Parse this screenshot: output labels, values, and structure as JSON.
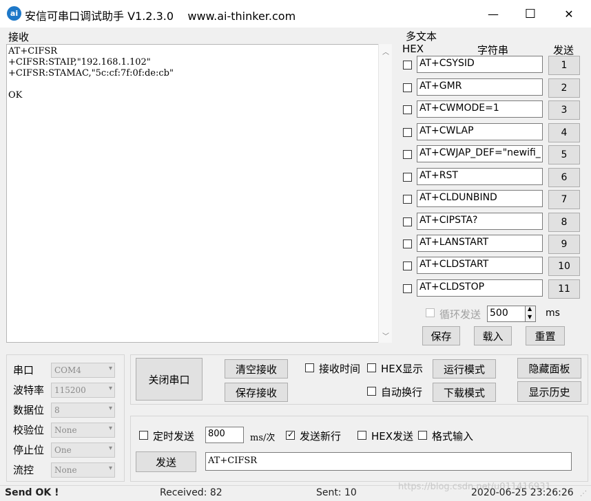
{
  "window": {
    "title": "安信可串口调试助手 V1.2.3.0    www.ai-thinker.com",
    "icon_text": "ai",
    "controls": {
      "minimize": "—",
      "maximize": "☐",
      "close": "✕"
    }
  },
  "receive": {
    "label": "接收",
    "lines": "AT+CIFSR\n+CIFSR:STAIP,\"192.168.1.102\"\n+CIFSR:STAMAC,\"5c:cf:7f:0f:de:cb\"\n\nOK"
  },
  "multi": {
    "label": "多文本",
    "hex_header": "HEX",
    "string_header": "字符串",
    "send_header": "发送",
    "rows": [
      {
        "text": "AT+CSYSID",
        "num": "1"
      },
      {
        "text": "AT+GMR",
        "num": "2"
      },
      {
        "text": "AT+CWMODE=1",
        "num": "3"
      },
      {
        "text": "AT+CWLAP",
        "num": "4"
      },
      {
        "text": "AT+CWJAP_DEF=\"newifi_",
        "num": "5"
      },
      {
        "text": "AT+RST",
        "num": "6"
      },
      {
        "text": "AT+CLDUNBIND",
        "num": "7"
      },
      {
        "text": "AT+CIPSTA?",
        "num": "8"
      },
      {
        "text": "AT+LANSTART",
        "num": "9"
      },
      {
        "text": "AT+CLDSTART",
        "num": "10"
      },
      {
        "text": "AT+CLDSTOP",
        "num": "11"
      }
    ],
    "loop_label": "循环发送",
    "loop_value": "500",
    "loop_unit": "ms",
    "save": "保存",
    "load": "载入",
    "reset": "重置"
  },
  "port": {
    "rows": [
      {
        "label": "串口",
        "value": "COM4"
      },
      {
        "label": "波特率",
        "value": "115200"
      },
      {
        "label": "数据位",
        "value": "8"
      },
      {
        "label": "校验位",
        "value": "None"
      },
      {
        "label": "停止位",
        "value": "One"
      },
      {
        "label": "流控",
        "value": "None"
      }
    ]
  },
  "controls": {
    "close_port": "关闭串口",
    "clear_recv": "清空接收",
    "save_recv": "保存接收",
    "recv_time": "接收时间",
    "hex_display": "HEX显示",
    "auto_wrap": "自动换行",
    "run_mode": "运行模式",
    "download_mode": "下载模式",
    "hide_panel": "隐藏面板",
    "show_history": "显示历史"
  },
  "send": {
    "timed_send": "定时发送",
    "interval_value": "800",
    "interval_unit": "ms/次",
    "send_newline": "发送新行",
    "hex_send": "HEX发送",
    "format_input": "格式输入",
    "send_button": "发送",
    "input_value": "AT+CIFSR"
  },
  "status": {
    "send_ok": "Send OK !",
    "received": "Received: 82",
    "sent": "Sent: 10",
    "datetime": "2020-06-25 23:26:26",
    "watermark": "https://blog.csdn.net/u011416931"
  }
}
